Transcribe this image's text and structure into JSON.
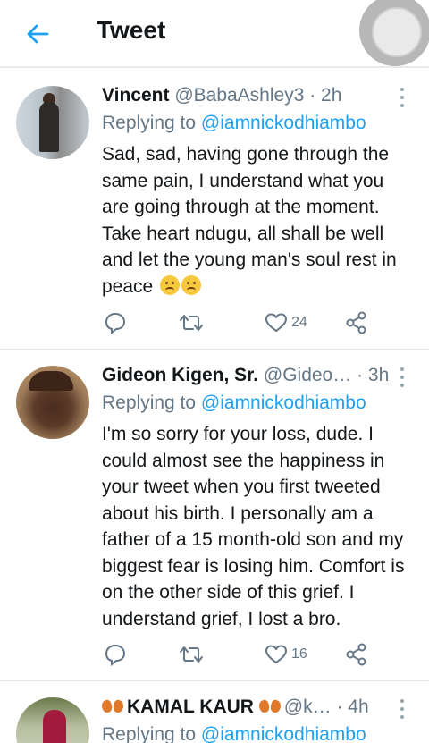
{
  "header": {
    "title": "Tweet",
    "back_icon": "arrow-left-icon",
    "accent": "#1da1f2"
  },
  "tweets": [
    {
      "name": "Vincent",
      "handle": "@BabaAshley3",
      "time": "· 2h",
      "replying_prefix": "Replying to ",
      "replying_handle": "@iamnickodhiambo",
      "body": "Sad, sad, having gone through the same pain, I understand what you are going through at the moment. Take heart ndugu, all shall be well and let the young man's soul rest in peace",
      "emoji": "😟😟",
      "likes": "24"
    },
    {
      "name": "Gideon Kigen, Sr.",
      "handle": "@Gideo…",
      "time": " · 3h",
      "replying_prefix": "Replying to ",
      "replying_handle": "@iamnickodhiambo",
      "body": "I'm so sorry for your loss, dude. I could almost see the happiness in your tweet when you first tweeted about his birth. I personally am a father of a 15 month-old son and my biggest fear is losing him. Comfort is on the other side of this grief. I understand grief, I lost a bro.",
      "likes": "16"
    },
    {
      "name": "KAMAL KAUR",
      "handle": "@k…",
      "time": " · 4h",
      "replying_prefix": "Replying to ",
      "replying_handle": "@iamnickodhiambo"
    }
  ],
  "colors": {
    "text": "#14171a",
    "secondary": "#657786",
    "link": "#1da1f2",
    "divider": "#e1e4e8"
  }
}
